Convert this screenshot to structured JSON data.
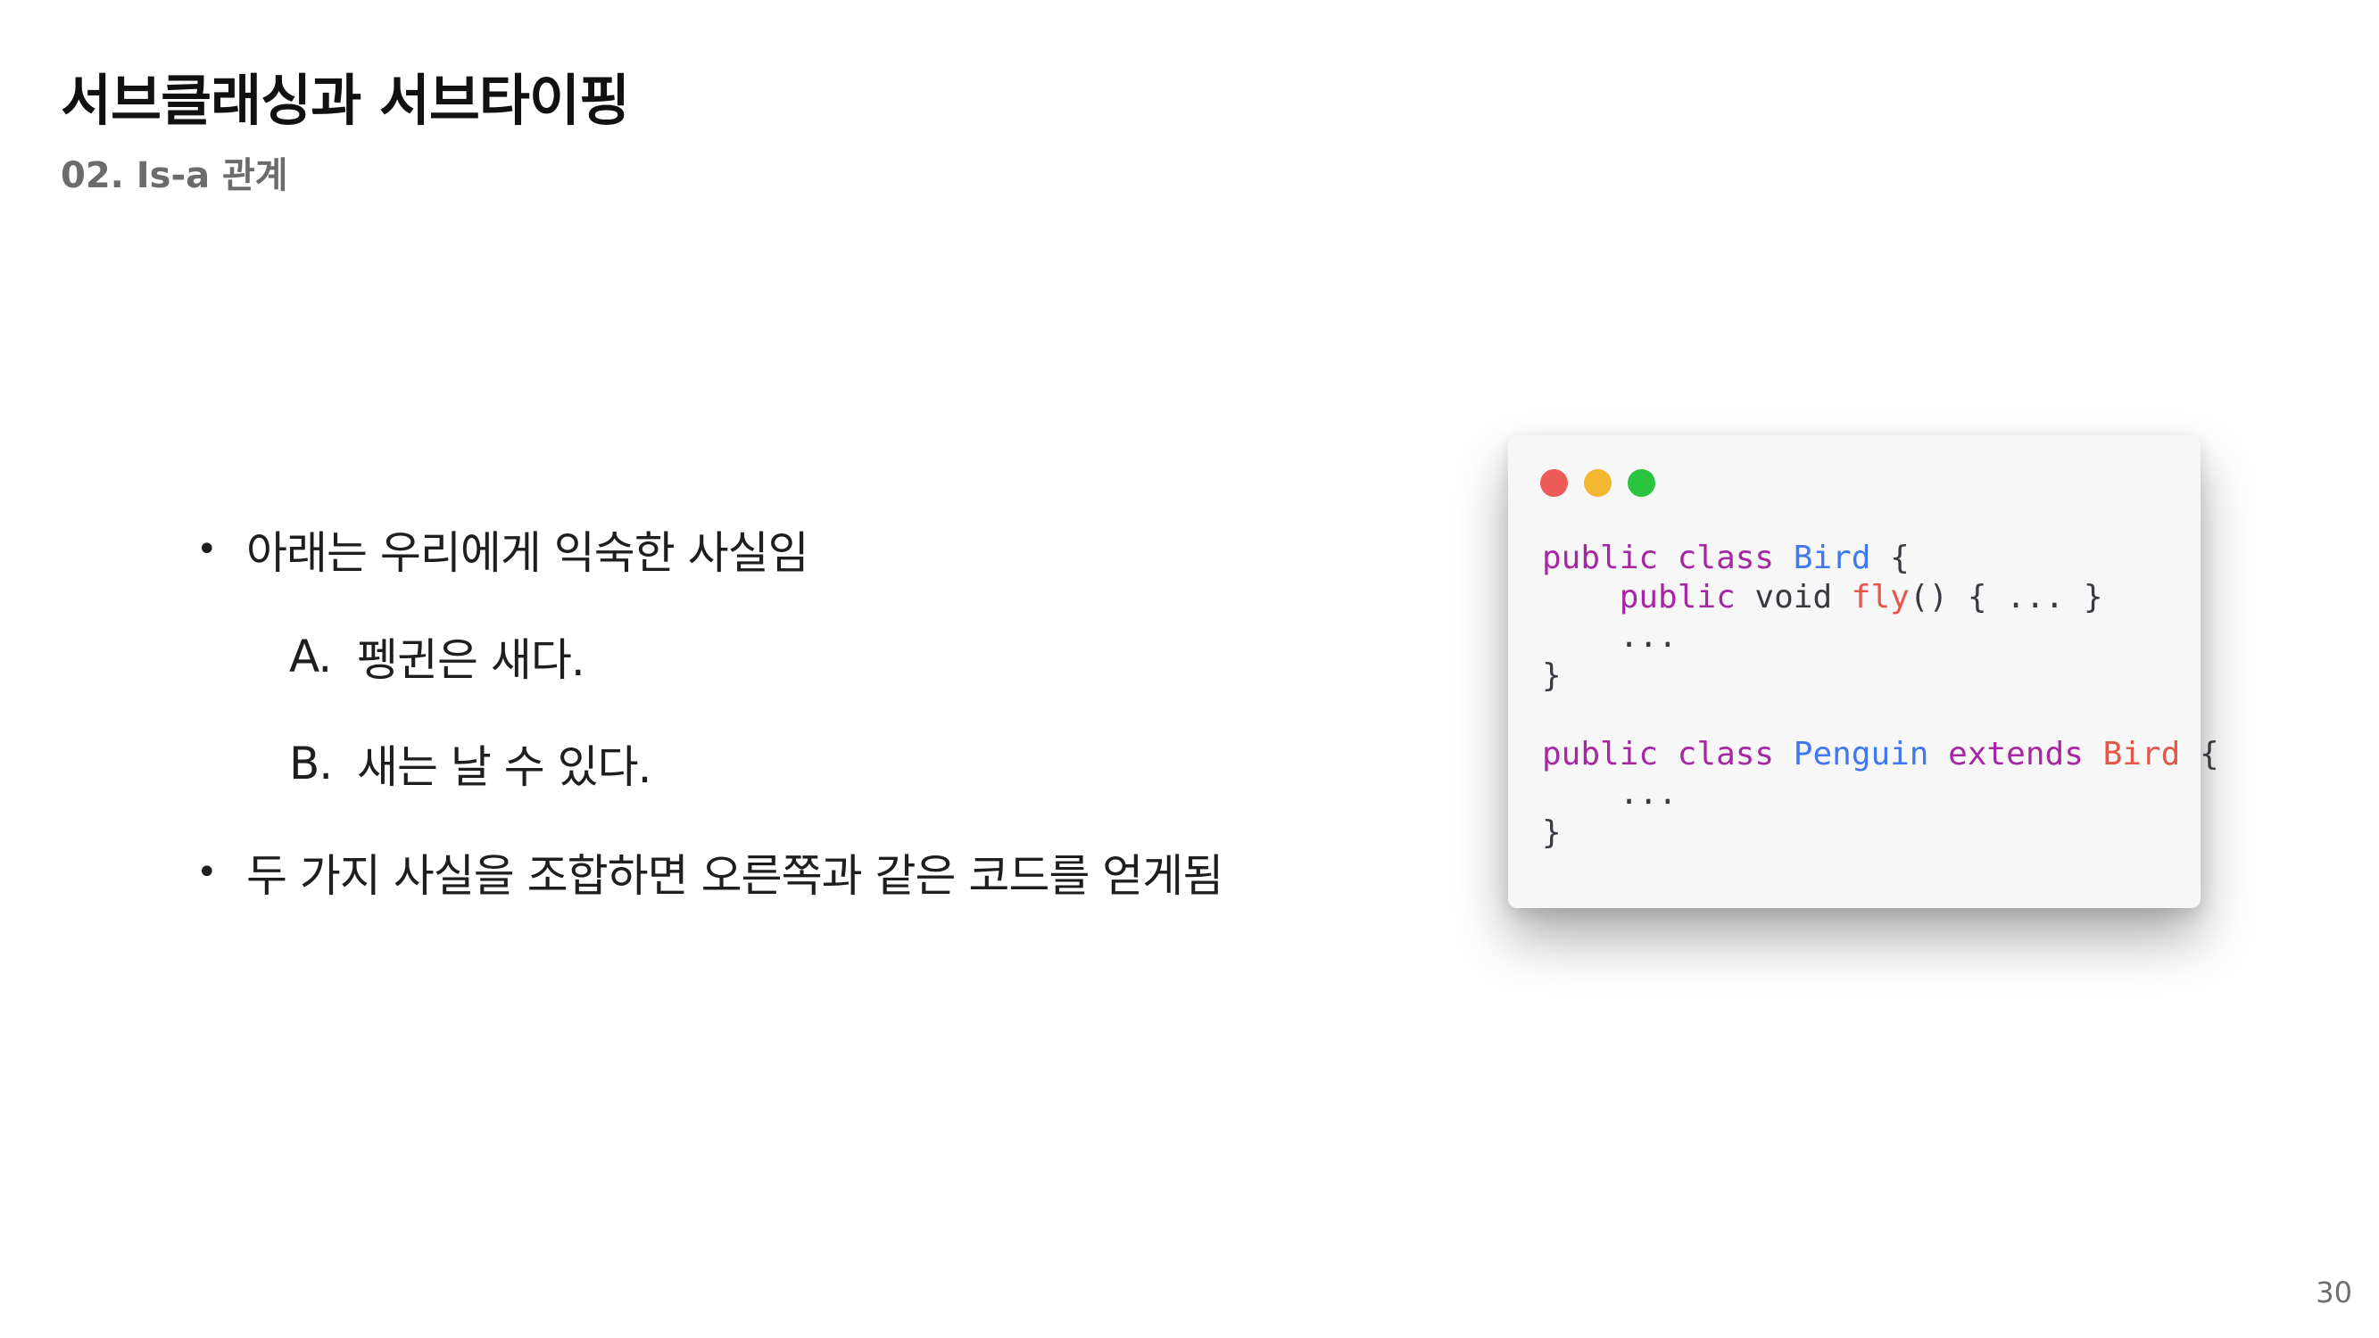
{
  "slide": {
    "title": "서브클래싱과 서브타이핑",
    "subtitle": "02. Is-a 관계",
    "page_number": "30"
  },
  "bullets": [
    {
      "marker": "•",
      "text": "아래는 우리에게 익숙한 사실임",
      "sub_items": [
        {
          "marker": "A.",
          "text": "펭귄은 새다."
        },
        {
          "marker": "B.",
          "text": "새는 날 수 있다."
        }
      ]
    },
    {
      "marker": "•",
      "text": "두 가지 사실을 조합하면 오른쪽과 같은 코드를 얻게됨",
      "sub_items": []
    }
  ],
  "code_window": {
    "traffic_lights": [
      {
        "name": "close-icon",
        "color": "#ee5a57"
      },
      {
        "name": "minimize-icon",
        "color": "#f4b730"
      },
      {
        "name": "maximize-icon",
        "color": "#2bc43f"
      }
    ],
    "colors": {
      "keyword": "#a626a4",
      "type": "#4078f2",
      "method": "#e45649",
      "plain": "#383a42"
    },
    "lines": [
      [
        {
          "t": "public class ",
          "c": "keyword"
        },
        {
          "t": "Bird",
          "c": "type"
        },
        {
          "t": " {",
          "c": "plain"
        }
      ],
      [
        {
          "t": "    public ",
          "c": "keyword"
        },
        {
          "t": "void ",
          "c": "plain"
        },
        {
          "t": "fly",
          "c": "method"
        },
        {
          "t": "() { ... }",
          "c": "plain"
        }
      ],
      [
        {
          "t": "    ...",
          "c": "plain"
        }
      ],
      [
        {
          "t": "}",
          "c": "plain"
        }
      ],
      [],
      [
        {
          "t": "public class ",
          "c": "keyword"
        },
        {
          "t": "Penguin",
          "c": "type"
        },
        {
          "t": " extends ",
          "c": "keyword"
        },
        {
          "t": "Bird",
          "c": "method"
        },
        {
          "t": " {",
          "c": "plain"
        }
      ],
      [
        {
          "t": "    ...",
          "c": "plain"
        }
      ],
      [
        {
          "t": "}",
          "c": "plain"
        }
      ]
    ]
  }
}
